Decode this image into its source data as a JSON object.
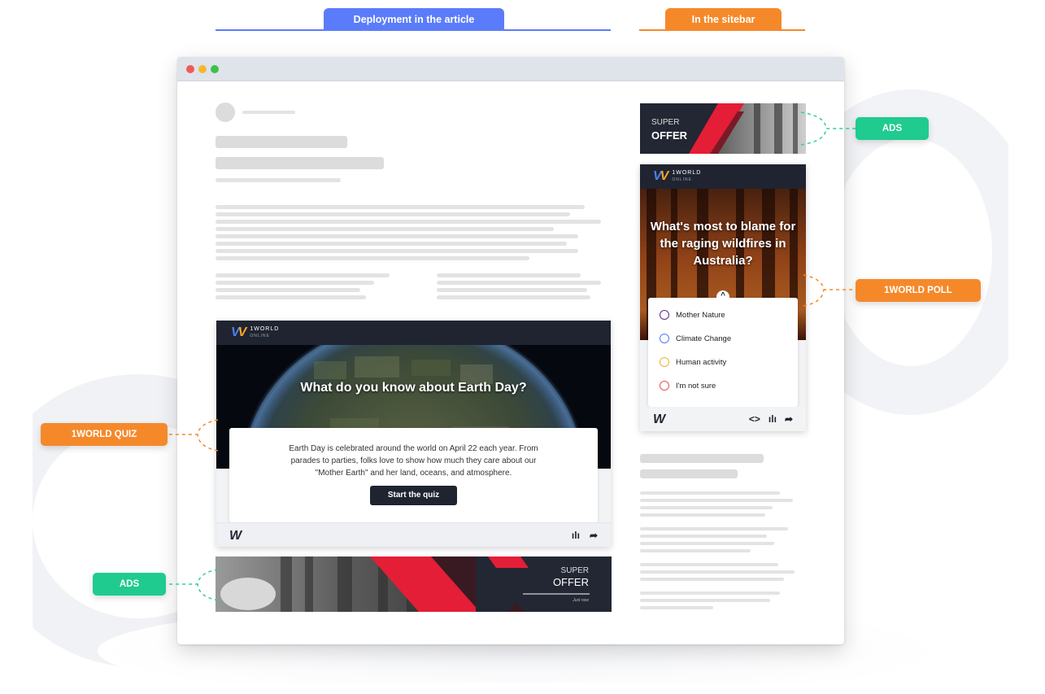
{
  "tabs": {
    "article": "Deployment in the article",
    "sidebar": "In the sitebar"
  },
  "callouts": {
    "ads_right": "ADS",
    "poll": "1WORLD POLL",
    "quiz": "1WORLD QUIZ",
    "ads_left": "ADS"
  },
  "quiz": {
    "title": "What do you know about Earth Day?",
    "description": "Earth Day is celebrated around the world on April 22 each year. From parades to parties, folks love to show how much they care about our \"Mother Earth\" and her land, oceans, and atmosphere.",
    "button": "Start the quiz"
  },
  "poll": {
    "title": "What's most to blame for the raging wildfires in Australia?",
    "options": [
      {
        "label": "Mother Nature",
        "color": "#5b2a86"
      },
      {
        "label": "Climate Change",
        "color": "#4f7ef0"
      },
      {
        "label": "Human activity",
        "color": "#f2b233"
      },
      {
        "label": "I'm not sure",
        "color": "#e25555"
      }
    ]
  },
  "ads": {
    "sidebar": {
      "line1": "SUPER",
      "line2": "OFFER"
    },
    "bottom": {
      "line1": "SUPER",
      "line2": "OFFER",
      "line3": "Just now"
    }
  },
  "brand": {
    "name": "1WORLD",
    "sub": "ONLINE"
  },
  "colors": {
    "article_accent": "#5b7cfa",
    "sidebar_accent": "#f5892a",
    "ads_accent": "#1fcb8f",
    "card_dark": "#1f2430",
    "ad_red": "#e41e36"
  },
  "icons": {
    "embed": "<>",
    "stats": "ılı",
    "share": "➦"
  }
}
